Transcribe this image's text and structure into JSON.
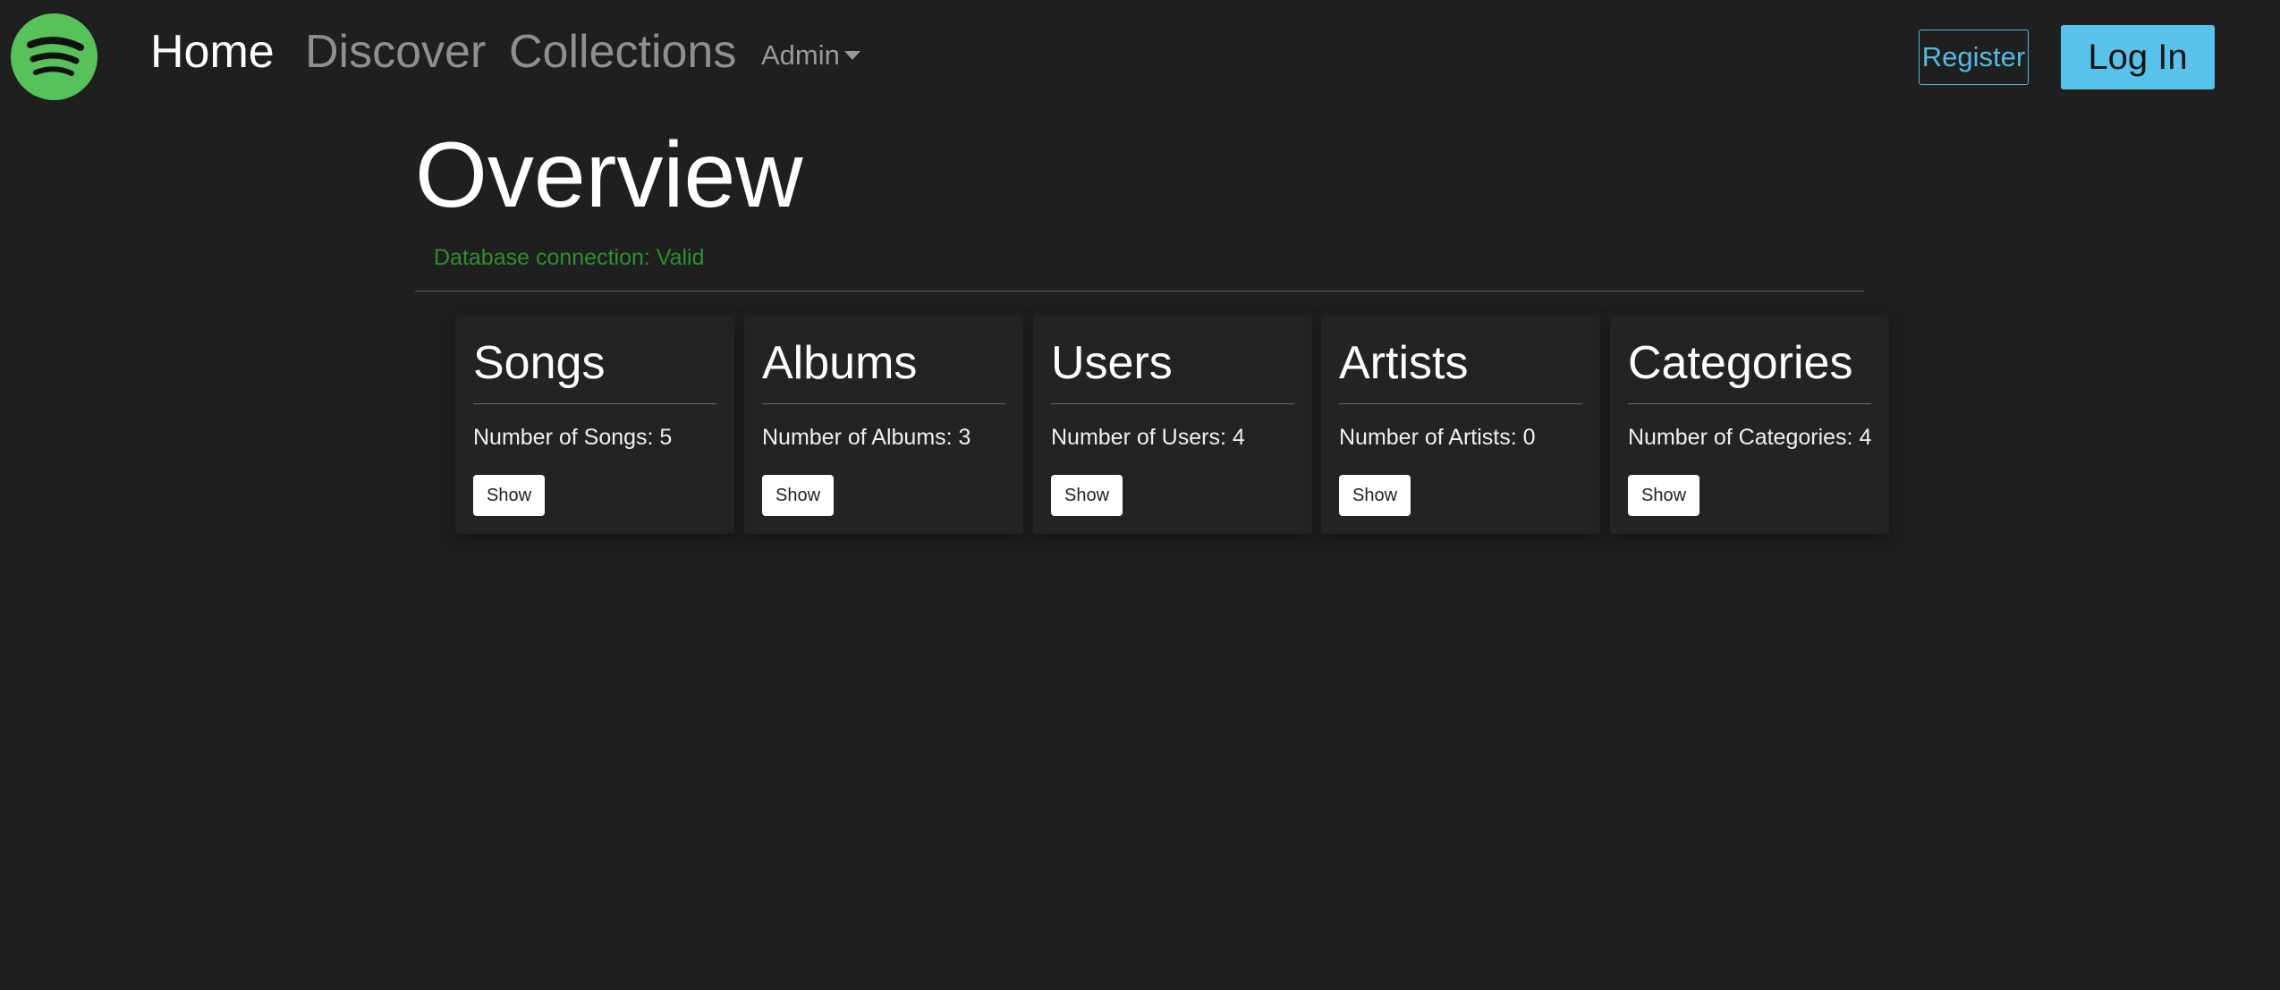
{
  "navbar": {
    "logo_icon": "spotify-logo-icon",
    "links": [
      {
        "label": "Home",
        "active": true
      },
      {
        "label": "Discover",
        "active": false
      },
      {
        "label": "Collections",
        "active": false
      }
    ],
    "admin_dropdown": {
      "label": "Admin",
      "icon": "caret-down-icon"
    },
    "register_label": "Register",
    "login_label": "Log In"
  },
  "main": {
    "title": "Overview",
    "db_status": "Database connection: Valid",
    "cards": [
      {
        "title": "Songs",
        "text": "Number of Songs: 5",
        "button": "Show"
      },
      {
        "title": "Albums",
        "text": "Number of Albums: 3",
        "button": "Show"
      },
      {
        "title": "Users",
        "text": "Number of Users: 4",
        "button": "Show"
      },
      {
        "title": "Artists",
        "text": "Number of Artists: 0",
        "button": "Show"
      },
      {
        "title": "Categories",
        "text": "Number of Categories: 4",
        "button": "Show"
      }
    ]
  },
  "colors": {
    "background": "#1f1f1f",
    "brand_green": "#57c25a",
    "accent_blue": "#59c2eb",
    "status_green": "#2f8f2f"
  }
}
